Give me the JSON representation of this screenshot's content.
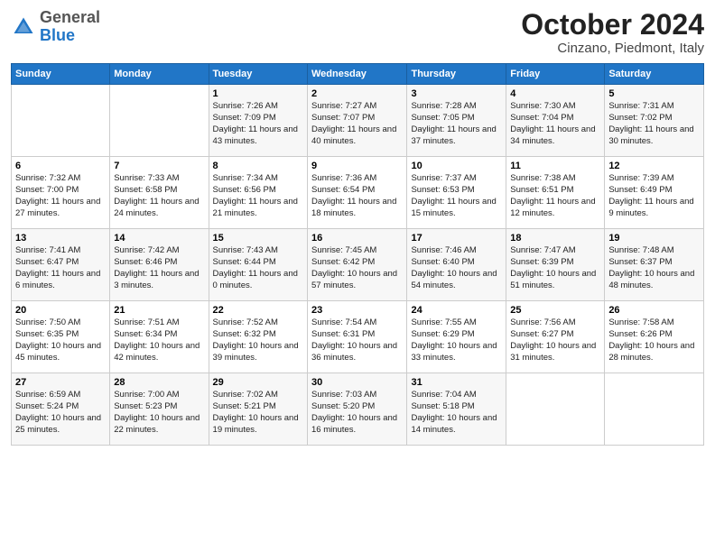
{
  "header": {
    "logo_general": "General",
    "logo_blue": "Blue",
    "title": "October 2024",
    "location": "Cinzano, Piedmont, Italy"
  },
  "days_of_week": [
    "Sunday",
    "Monday",
    "Tuesday",
    "Wednesday",
    "Thursday",
    "Friday",
    "Saturday"
  ],
  "weeks": [
    [
      {
        "day": "",
        "info": ""
      },
      {
        "day": "",
        "info": ""
      },
      {
        "day": "1",
        "info": "Sunrise: 7:26 AM\nSunset: 7:09 PM\nDaylight: 11 hours and 43 minutes."
      },
      {
        "day": "2",
        "info": "Sunrise: 7:27 AM\nSunset: 7:07 PM\nDaylight: 11 hours and 40 minutes."
      },
      {
        "day": "3",
        "info": "Sunrise: 7:28 AM\nSunset: 7:05 PM\nDaylight: 11 hours and 37 minutes."
      },
      {
        "day": "4",
        "info": "Sunrise: 7:30 AM\nSunset: 7:04 PM\nDaylight: 11 hours and 34 minutes."
      },
      {
        "day": "5",
        "info": "Sunrise: 7:31 AM\nSunset: 7:02 PM\nDaylight: 11 hours and 30 minutes."
      }
    ],
    [
      {
        "day": "6",
        "info": "Sunrise: 7:32 AM\nSunset: 7:00 PM\nDaylight: 11 hours and 27 minutes."
      },
      {
        "day": "7",
        "info": "Sunrise: 7:33 AM\nSunset: 6:58 PM\nDaylight: 11 hours and 24 minutes."
      },
      {
        "day": "8",
        "info": "Sunrise: 7:34 AM\nSunset: 6:56 PM\nDaylight: 11 hours and 21 minutes."
      },
      {
        "day": "9",
        "info": "Sunrise: 7:36 AM\nSunset: 6:54 PM\nDaylight: 11 hours and 18 minutes."
      },
      {
        "day": "10",
        "info": "Sunrise: 7:37 AM\nSunset: 6:53 PM\nDaylight: 11 hours and 15 minutes."
      },
      {
        "day": "11",
        "info": "Sunrise: 7:38 AM\nSunset: 6:51 PM\nDaylight: 11 hours and 12 minutes."
      },
      {
        "day": "12",
        "info": "Sunrise: 7:39 AM\nSunset: 6:49 PM\nDaylight: 11 hours and 9 minutes."
      }
    ],
    [
      {
        "day": "13",
        "info": "Sunrise: 7:41 AM\nSunset: 6:47 PM\nDaylight: 11 hours and 6 minutes."
      },
      {
        "day": "14",
        "info": "Sunrise: 7:42 AM\nSunset: 6:46 PM\nDaylight: 11 hours and 3 minutes."
      },
      {
        "day": "15",
        "info": "Sunrise: 7:43 AM\nSunset: 6:44 PM\nDaylight: 11 hours and 0 minutes."
      },
      {
        "day": "16",
        "info": "Sunrise: 7:45 AM\nSunset: 6:42 PM\nDaylight: 10 hours and 57 minutes."
      },
      {
        "day": "17",
        "info": "Sunrise: 7:46 AM\nSunset: 6:40 PM\nDaylight: 10 hours and 54 minutes."
      },
      {
        "day": "18",
        "info": "Sunrise: 7:47 AM\nSunset: 6:39 PM\nDaylight: 10 hours and 51 minutes."
      },
      {
        "day": "19",
        "info": "Sunrise: 7:48 AM\nSunset: 6:37 PM\nDaylight: 10 hours and 48 minutes."
      }
    ],
    [
      {
        "day": "20",
        "info": "Sunrise: 7:50 AM\nSunset: 6:35 PM\nDaylight: 10 hours and 45 minutes."
      },
      {
        "day": "21",
        "info": "Sunrise: 7:51 AM\nSunset: 6:34 PM\nDaylight: 10 hours and 42 minutes."
      },
      {
        "day": "22",
        "info": "Sunrise: 7:52 AM\nSunset: 6:32 PM\nDaylight: 10 hours and 39 minutes."
      },
      {
        "day": "23",
        "info": "Sunrise: 7:54 AM\nSunset: 6:31 PM\nDaylight: 10 hours and 36 minutes."
      },
      {
        "day": "24",
        "info": "Sunrise: 7:55 AM\nSunset: 6:29 PM\nDaylight: 10 hours and 33 minutes."
      },
      {
        "day": "25",
        "info": "Sunrise: 7:56 AM\nSunset: 6:27 PM\nDaylight: 10 hours and 31 minutes."
      },
      {
        "day": "26",
        "info": "Sunrise: 7:58 AM\nSunset: 6:26 PM\nDaylight: 10 hours and 28 minutes."
      }
    ],
    [
      {
        "day": "27",
        "info": "Sunrise: 6:59 AM\nSunset: 5:24 PM\nDaylight: 10 hours and 25 minutes."
      },
      {
        "day": "28",
        "info": "Sunrise: 7:00 AM\nSunset: 5:23 PM\nDaylight: 10 hours and 22 minutes."
      },
      {
        "day": "29",
        "info": "Sunrise: 7:02 AM\nSunset: 5:21 PM\nDaylight: 10 hours and 19 minutes."
      },
      {
        "day": "30",
        "info": "Sunrise: 7:03 AM\nSunset: 5:20 PM\nDaylight: 10 hours and 16 minutes."
      },
      {
        "day": "31",
        "info": "Sunrise: 7:04 AM\nSunset: 5:18 PM\nDaylight: 10 hours and 14 minutes."
      },
      {
        "day": "",
        "info": ""
      },
      {
        "day": "",
        "info": ""
      }
    ]
  ]
}
